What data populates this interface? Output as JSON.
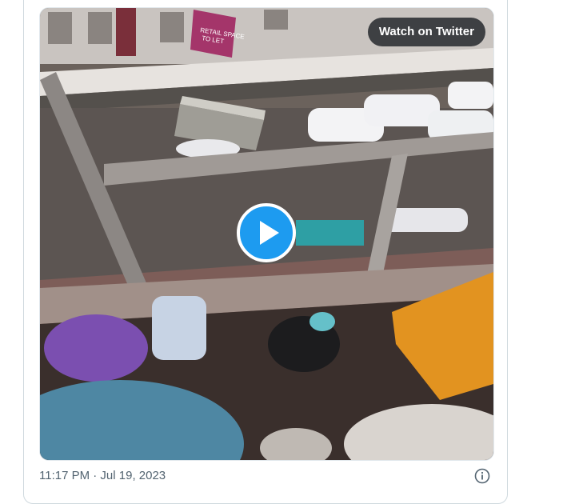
{
  "media": {
    "watch_label": "Watch on Twitter",
    "store_sign_lines": [
      "RETAIL SPACE",
      "TO LET"
    ]
  },
  "tweet": {
    "timestamp": "11:17 PM · Jul 19, 2023"
  },
  "icons": {
    "play": "play-icon",
    "info": "info-icon"
  },
  "colors": {
    "play_button": "#1d9bf0",
    "meta_text": "#536471",
    "border": "#cfd9de"
  }
}
